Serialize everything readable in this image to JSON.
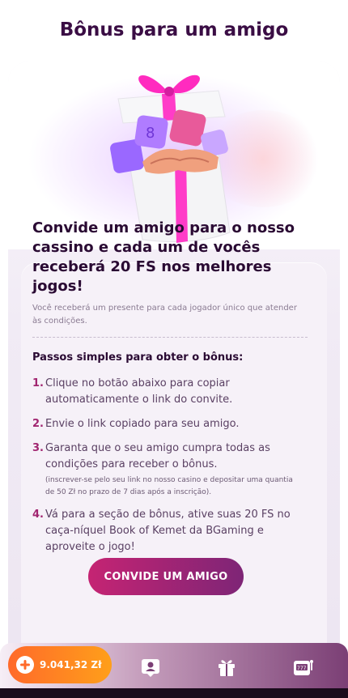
{
  "page": {
    "title": "Bônus para um amigo"
  },
  "invite": {
    "headline": "Convide um amigo para o nosso cassino e cada um de vocês receberá 20 FS nos melhores jogos!",
    "subline": "Você receberá um presente para cada jogador único que atender às condições.",
    "steps_title": "Passos simples para obter o bônus:",
    "steps": [
      {
        "num": "1.",
        "text": "Clique no botão abaixo para copiar automaticamente o link do convite.",
        "note": ""
      },
      {
        "num": "2.",
        "text": "Envie o link copiado para seu amigo.",
        "note": ""
      },
      {
        "num": "3.",
        "text": "Garanta que o seu amigo cumpra todas as condições para receber o bônus.",
        "note": "(inscrever-se pelo seu link no nosso casino e depositar uma quantia de 50 Zł no prazo de 7 dias após a inscrição)."
      },
      {
        "num": "4.",
        "text": "Vá para a seção de bônus, ative suas 20 FS no caça-níquel Book of Kemet da BGaming e aproveite o jogo!",
        "note": ""
      }
    ],
    "cta_label": "CONVIDE UM AMIGO"
  },
  "bottom_nav": {
    "balance": "9.041,32 Zł",
    "icons": [
      "plus-icon",
      "profile-card-icon",
      "gift-icon",
      "slot-machine-icon"
    ]
  },
  "colors": {
    "title": "#3a0d44",
    "step_number": "#a12570",
    "cta_start": "#c52473",
    "cta_end": "#7e2576",
    "balance_start": "#ff6a2a",
    "balance_end": "#ff9f1a"
  }
}
